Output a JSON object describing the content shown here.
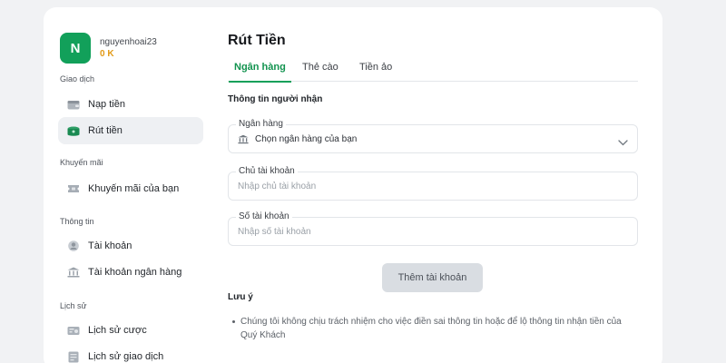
{
  "user": {
    "avatar_letter": "N",
    "username": "nguyenhoai23",
    "balance": "0 K"
  },
  "sidebar": {
    "sections": [
      {
        "title": "Giao dịch",
        "items": [
          {
            "label": "Nạp tiền",
            "icon": "wallet-icon"
          },
          {
            "label": "Rút tiền",
            "icon": "money-stack-icon",
            "active": true
          }
        ]
      },
      {
        "title": "Khuyến mãi",
        "items": [
          {
            "label": "Khuyến mãi của bạn",
            "icon": "ticket-icon"
          }
        ]
      },
      {
        "title": "Thông tin",
        "items": [
          {
            "label": "Tài khoản",
            "icon": "user-icon"
          },
          {
            "label": "Tài khoản ngân hàng",
            "icon": "bank-icon"
          }
        ]
      },
      {
        "title": "Lịch sử",
        "items": [
          {
            "label": "Lịch sử cược",
            "icon": "bet-history-icon"
          },
          {
            "label": "Lịch sử giao dịch",
            "icon": "transaction-history-icon"
          }
        ]
      }
    ]
  },
  "main": {
    "title": "Rút Tiền",
    "tabs": [
      {
        "label": "Ngân hàng",
        "active": true
      },
      {
        "label": "Thẻ cào"
      },
      {
        "label": "Tiền ảo"
      }
    ],
    "subheading": "Thông tin người nhận",
    "bank_select": {
      "label": "Ngân hàng",
      "value": "Chọn ngân hàng của bạn"
    },
    "account_holder": {
      "label": "Chủ tài khoản",
      "placeholder": "Nhập chủ tài khoản",
      "value": ""
    },
    "account_number": {
      "label": "Số tài khoản",
      "placeholder": "Nhập số tài khoản",
      "value": ""
    },
    "submit_label": "Thêm tài khoản",
    "note_title": "Lưu ý",
    "note_text": "Chúng tôi không chịu trách nhiệm cho việc điền sai thông tin hoặc để lộ thông tin nhận tiền của Quý Khách"
  },
  "colors": {
    "accent": "#12a05a",
    "balance": "#e29a17",
    "page_background": "#f1f2f4",
    "button_disabled": "#d9dde2"
  }
}
